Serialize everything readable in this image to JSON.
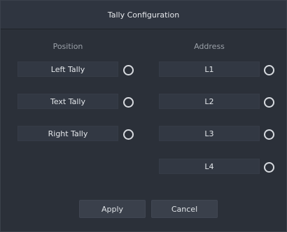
{
  "dialog": {
    "title": "Tally Configuration"
  },
  "columns": {
    "position_header": "Position",
    "address_header": "Address"
  },
  "position_rows": [
    {
      "label": "Left Tally"
    },
    {
      "label": "Text Tally"
    },
    {
      "label": "Right Tally"
    }
  ],
  "address_rows": [
    {
      "label": "L1"
    },
    {
      "label": "L2"
    },
    {
      "label": "L3"
    },
    {
      "label": "L4"
    }
  ],
  "buttons": {
    "apply": "Apply",
    "cancel": "Cancel"
  },
  "colors": {
    "background": "#2b3039",
    "field": "#323843",
    "button": "#3a404b",
    "text": "#e3e6ea",
    "muted_text": "#9aa0a8"
  }
}
